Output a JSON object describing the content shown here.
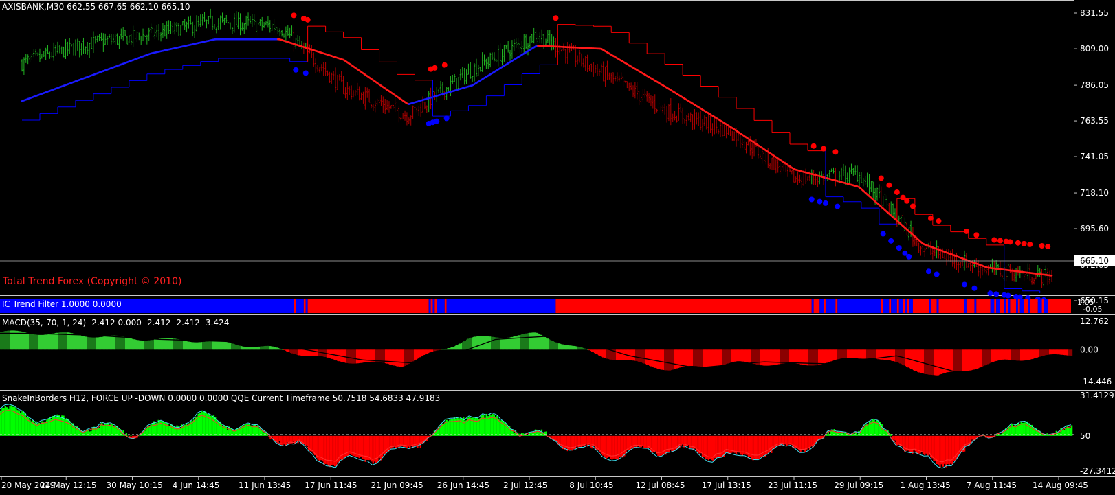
{
  "colors": {
    "background": "#000000",
    "bull_candle": "#22b322",
    "bear_candle": "#b00000",
    "ma_down": "#ff1a1a",
    "ma_up": "#1a1aff",
    "stop_red": "#ff0000",
    "stop_blue": "#0000ff",
    "panel_border": "#c8c8c8",
    "axis_text": "#ffffff",
    "macd_green_light": "#33cc33",
    "macd_green_dark": "#1a7a1a",
    "macd_red_light": "#ff0000",
    "macd_red_dark": "#8b0000",
    "qqe_green": "#00ff00",
    "qqe_red": "#ff0000",
    "qqe_line_cyan": "#40e0f0",
    "watermark": "#ff2020"
  },
  "main": {
    "header": "AXISBANK,M30   662.55 667.65 662.10 665.10",
    "watermark": "Total Trend Forex (Copyright © 2010)",
    "current_price_label": "665.10",
    "y_ticks": [
      "831.55",
      "809.00",
      "786.05",
      "763.55",
      "741.05",
      "718.10",
      "695.60",
      "672.65",
      "650.15"
    ]
  },
  "trend_filter": {
    "header": "IC Trend Filter 1.0000 0.0000",
    "y_top": "1.05",
    "y_bottom": "-0.05"
  },
  "macd": {
    "header": "MACD(35,-70, 1, 24) -2.412 0.000 -2.412 -2.412 -3.424",
    "y_ticks": [
      "12.762",
      "0.00",
      "-14.446"
    ]
  },
  "qqe": {
    "header": "SnakeInBorders H12, FORCE UP -DOWN  0.0000 0.0000  QQE Current Timeframe 50.7518 54.6833 47.9183",
    "y_ticks": [
      "31.4129",
      "50",
      "-27.3412"
    ]
  },
  "x_labels": [
    "20 May 2019",
    "24 May 12:15",
    "30 May 10:15",
    "4 Jun 14:45",
    "11 Jun 13:45",
    "17 Jun 11:45",
    "21 Jun 09:45",
    "26 Jun 14:45",
    "2 Jul 12:45",
    "8 Jul 10:45",
    "12 Jul 08:45",
    "17 Jul 13:15",
    "23 Jul 11:15",
    "29 Jul 09:15",
    "1 Aug 13:45",
    "7 Aug 11:45",
    "14 Aug 09:45"
  ],
  "chart_data": [
    {
      "type": "line",
      "title": "AXISBANK,M30",
      "ohlc_last": {
        "open": 662.55,
        "high": 667.65,
        "low": 662.1,
        "close": 665.1
      },
      "x": [
        "20 May 2019",
        "24 May 12:15",
        "30 May 10:15",
        "4 Jun 14:45",
        "11 Jun 13:45",
        "17 Jun 11:45",
        "21 Jun 09:45",
        "26 Jun 14:45",
        "2 Jul 12:45",
        "8 Jul 10:45",
        "12 Jul 08:45",
        "17 Jul 13:15",
        "23 Jul 11:15",
        "29 Jul 09:15",
        "1 Aug 13:45",
        "7 Aug 11:45",
        "14 Aug 09:45"
      ],
      "series": [
        {
          "values": [
            800,
            812,
            818,
            826,
            823,
            784,
            767,
            796,
            818,
            794,
            770,
            757,
            727,
            730,
            683,
            670,
            665
          ]
        },
        {
          "values": [
            776,
            791,
            806,
            815,
            815,
            802,
            774,
            786,
            811,
            809,
            785,
            760,
            733,
            722,
            686,
            671,
            666
          ]
        }
      ],
      "ylim": [
        650.15,
        831.55
      ]
    },
    {
      "type": "bar",
      "title": "MACD(35,-70, 1, 24)",
      "x": [
        "20 May 2019",
        "24 May 12:15",
        "30 May 10:15",
        "4 Jun 14:45",
        "11 Jun 13:45",
        "17 Jun 11:45",
        "21 Jun 09:45",
        "26 Jun 14:45",
        "2 Jul 12:45",
        "8 Jul 10:45",
        "12 Jul 08:45",
        "17 Jul 13:15",
        "23 Jul 11:15",
        "29 Jul 09:15",
        "1 Aug 13:45",
        "7 Aug 11:45",
        "14 Aug 09:45"
      ],
      "values": [
        8,
        7,
        5,
        4,
        1,
        -5,
        -7,
        5,
        7,
        -3,
        -9,
        -6,
        -7,
        -3,
        -12,
        -5,
        -2
      ],
      "ylim": [
        -14.446,
        12.762
      ]
    },
    {
      "type": "area",
      "title": "QQE Current Timeframe",
      "x": [
        "20 May 2019",
        "24 May 12:15",
        "30 May 10:15",
        "4 Jun 14:45",
        "11 Jun 13:45",
        "17 Jun 11:45",
        "21 Jun 09:45",
        "26 Jun 14:45",
        "2 Jul 12:45",
        "8 Jul 10:45",
        "12 Jul 08:45",
        "17 Jul 13:15",
        "23 Jul 11:15",
        "29 Jul 09:15",
        "1 Aug 13:45",
        "7 Aug 11:45",
        "14 Aug 09:45"
      ],
      "values": [
        20,
        10,
        3,
        15,
        2,
        -22,
        -12,
        18,
        1,
        -15,
        -10,
        -17,
        -8,
        10,
        -24,
        8,
        3
      ],
      "ylim": [
        -27.3412,
        31.4129
      ]
    }
  ]
}
